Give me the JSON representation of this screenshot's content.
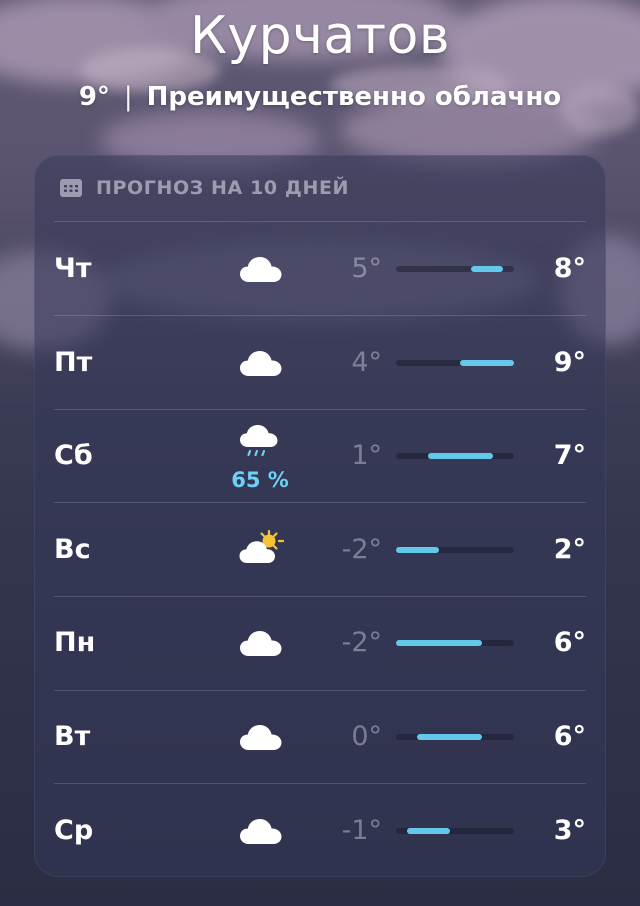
{
  "location": {
    "city": "Курчатов",
    "current_temp": "9°",
    "separator": "|",
    "condition": "Преимущественно облачно"
  },
  "forecast": {
    "header_icon": "calendar-icon",
    "title": "ПРОГНОЗ НА 10 ДНЕЙ",
    "range_min": -2,
    "range_max": 9,
    "days": [
      {
        "day": "Чт",
        "icon": "cloud-icon",
        "precip": "",
        "low": "5°",
        "high": "8°",
        "low_value": 5,
        "high_value": 8
      },
      {
        "day": "Пт",
        "icon": "cloud-icon",
        "precip": "",
        "low": "4°",
        "high": "9°",
        "low_value": 4,
        "high_value": 9
      },
      {
        "day": "Сб",
        "icon": "cloud-drizzle-icon",
        "precip": "65 %",
        "low": "1°",
        "high": "7°",
        "low_value": 1,
        "high_value": 7
      },
      {
        "day": "Вс",
        "icon": "cloud-sun-icon",
        "precip": "",
        "low": "-2°",
        "high": "2°",
        "low_value": -2,
        "high_value": 2
      },
      {
        "day": "Пн",
        "icon": "cloud-icon",
        "precip": "",
        "low": "-2°",
        "high": "6°",
        "low_value": -2,
        "high_value": 6
      },
      {
        "day": "Вт",
        "icon": "cloud-icon",
        "precip": "",
        "low": "0°",
        "high": "6°",
        "low_value": 0,
        "high_value": 6
      },
      {
        "day": "Ср",
        "icon": "cloud-icon",
        "precip": "",
        "low": "-1°",
        "high": "3°",
        "low_value": -1,
        "high_value": 3
      }
    ]
  },
  "colors": {
    "bar_fill": "#63c9ea",
    "precip_text": "#6fd0f5",
    "sun": "#f5c335"
  }
}
